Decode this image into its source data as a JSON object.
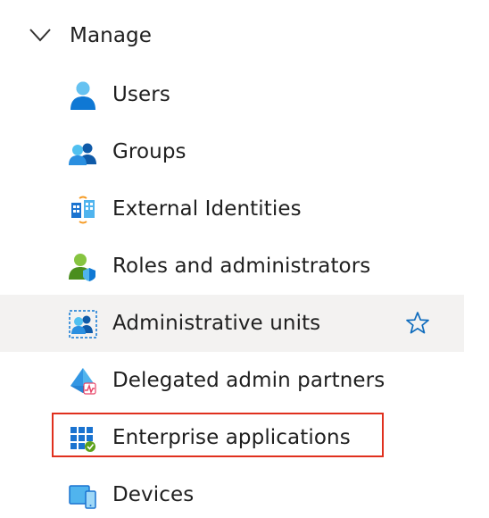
{
  "section": {
    "title": "Manage",
    "expanded": true
  },
  "items": [
    {
      "label": "Users",
      "icon": "user-icon"
    },
    {
      "label": "Groups",
      "icon": "groups-icon"
    },
    {
      "label": "External Identities",
      "icon": "external-identities-icon"
    },
    {
      "label": "Roles and administrators",
      "icon": "roles-icon"
    },
    {
      "label": "Administrative units",
      "icon": "administrative-units-icon",
      "hovered": true,
      "favorite_icon": "star-outline-icon"
    },
    {
      "label": "Delegated admin partners",
      "icon": "delegated-admin-icon"
    },
    {
      "label": "Enterprise applications",
      "icon": "enterprise-apps-icon",
      "highlighted": true
    },
    {
      "label": "Devices",
      "icon": "devices-icon"
    }
  ],
  "colors": {
    "hover_background": "#f3f2f1",
    "highlight_border": "#e0301e",
    "star": "#0f6cbd",
    "icon_blue": "#0078d4",
    "icon_light_blue": "#50e6ff",
    "icon_green": "#5ea21b"
  }
}
